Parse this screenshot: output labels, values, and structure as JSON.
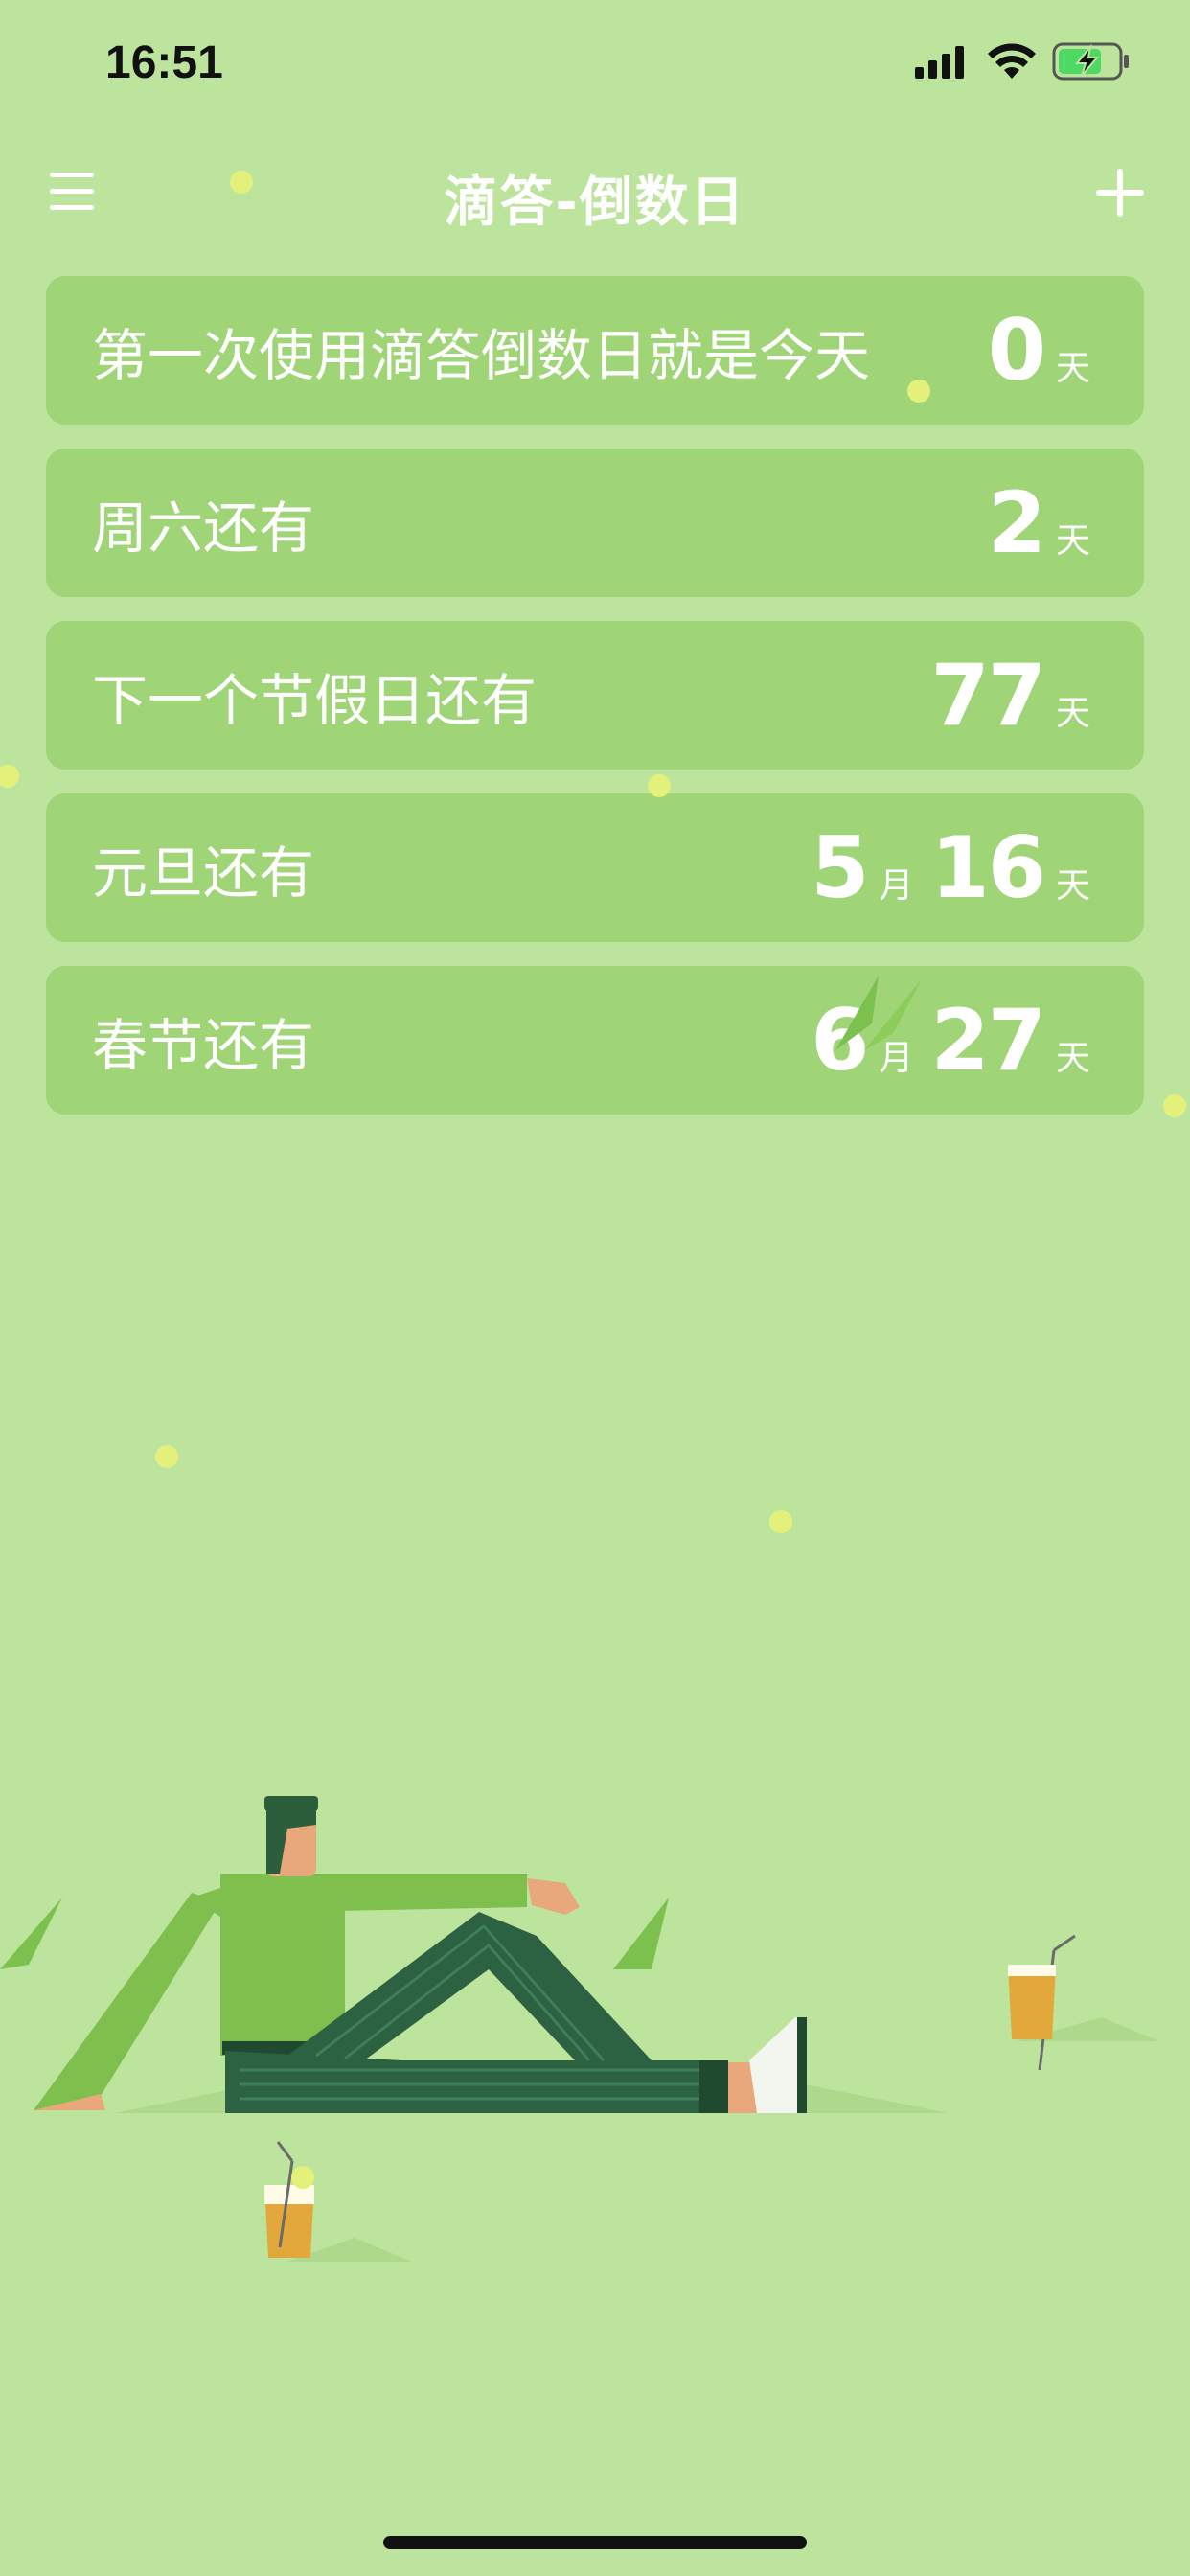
{
  "status_bar": {
    "time": "16:51"
  },
  "nav": {
    "title": "滴答-倒数日",
    "menu_icon": "hamburger-menu-icon",
    "add_icon": "plus-icon"
  },
  "events": [
    {
      "title": "第一次使用滴答倒数日就是今天",
      "days": "0",
      "day_unit": "天"
    },
    {
      "title": "周六还有",
      "days": "2",
      "day_unit": "天"
    },
    {
      "title": "下一个节假日还有",
      "days": "77",
      "day_unit": "天"
    },
    {
      "title": "元旦还有",
      "months": "5",
      "month_unit": "月",
      "days": "16",
      "day_unit": "天"
    },
    {
      "title": "春节还有",
      "months": "6",
      "month_unit": "月",
      "days": "27",
      "day_unit": "天"
    }
  ],
  "colors": {
    "background": "#bde49d",
    "card": "#9fd477",
    "text": "#ffffff",
    "dots": "#e3f07a"
  }
}
